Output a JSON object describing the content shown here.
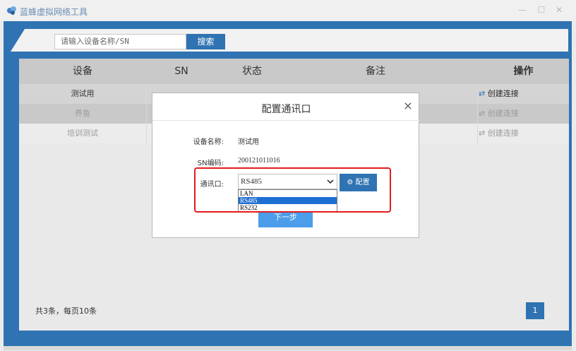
{
  "app": {
    "title": "蓝蜂虚拟网络工具"
  },
  "search": {
    "placeholder": "请输入设备名称/SN",
    "button_label": "搜索"
  },
  "table": {
    "headers": [
      "设备",
      "SN",
      "状态",
      "备注",
      "操作"
    ],
    "rows": [
      {
        "device": "测试用",
        "sn": "",
        "status": "",
        "note": "",
        "action": "创建连接"
      },
      {
        "device": "养鱼",
        "sn": "",
        "status": "",
        "note": "",
        "action": "创建连接"
      },
      {
        "device": "培训测试",
        "sn": "",
        "status": "",
        "note": "",
        "action": "创建连接"
      }
    ]
  },
  "footer": {
    "summary": "共3条，每页10条",
    "page": "1"
  },
  "modal": {
    "title": "配置通讯口",
    "close": "×",
    "fields": {
      "device_name_label": "设备名称:",
      "device_name_value": "测试用",
      "sn_label": "SN编码:",
      "sn_value": "200121011016",
      "port_label": "通讯口:"
    },
    "select": {
      "value": "RS485",
      "options": [
        "LAN",
        "RS485",
        "RS232"
      ],
      "selected_index": 1
    },
    "config_button": "配置",
    "next_button": "下一步"
  },
  "colors": {
    "primary": "#2f73b2",
    "highlight": "#e21d1d",
    "selection": "#1e6fd2",
    "next_button": "#4c9dea"
  }
}
